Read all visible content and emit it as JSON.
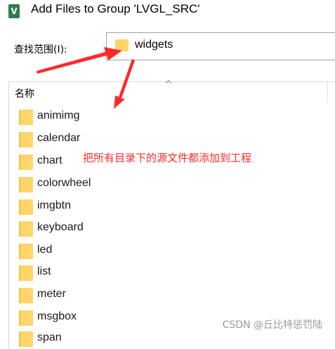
{
  "window": {
    "icon_text": "V",
    "title": "Add Files to Group 'LVGL_SRC'"
  },
  "lookin": {
    "label": "查找范围(I):",
    "value": "widgets"
  },
  "filelist": {
    "column_name": "名称",
    "sort_indicator": "^",
    "items": [
      "animimg",
      "calendar",
      "chart",
      "colorwheel",
      "imgbtn",
      "keyboard",
      "led",
      "list",
      "meter",
      "msgbox",
      "span"
    ]
  },
  "annotation": {
    "text": "把所有目录下的源文件都添加到工程",
    "color": "#ff2a2a"
  },
  "watermark": "CSDN @丘比特惩罚陆",
  "colors": {
    "folder": "#ffd56a",
    "arrow": "#ff2a2a"
  },
  "icons": [
    "app-icon",
    "folder-icon",
    "sort-ascending-icon"
  ]
}
